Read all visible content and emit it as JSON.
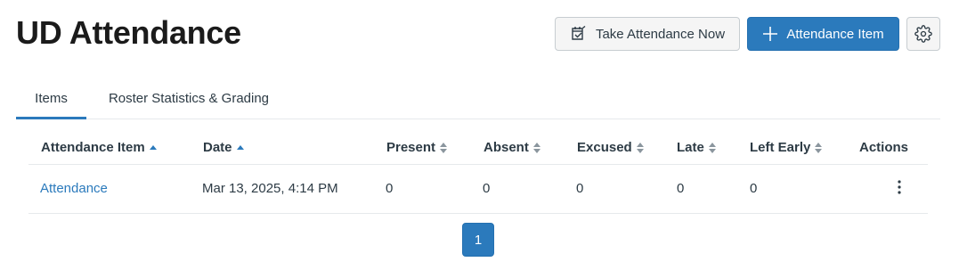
{
  "header": {
    "title": "UD Attendance",
    "take_attendance_label": "Take Attendance Now",
    "add_item_label": "Attendance Item"
  },
  "tabs": [
    {
      "label": "Items",
      "active": true
    },
    {
      "label": "Roster Statistics & Grading",
      "active": false
    }
  ],
  "table": {
    "columns": [
      "Attendance Item",
      "Date",
      "Present",
      "Absent",
      "Excused",
      "Late",
      "Left Early",
      "Actions"
    ],
    "rows": [
      {
        "item": "Attendance",
        "date": "Mar 13, 2025, 4:14 PM",
        "present": "0",
        "absent": "0",
        "excused": "0",
        "late": "0",
        "left_early": "0"
      }
    ]
  },
  "pagination": {
    "current_page": "1"
  },
  "icons": {
    "take_attendance": "calendar-check-icon",
    "add": "plus-icon",
    "settings": "gear-icon",
    "row_menu": "kebab-icon"
  },
  "colors": {
    "accent": "#2b7abc",
    "text": "#2d3b45",
    "border": "#c7cdd1"
  }
}
